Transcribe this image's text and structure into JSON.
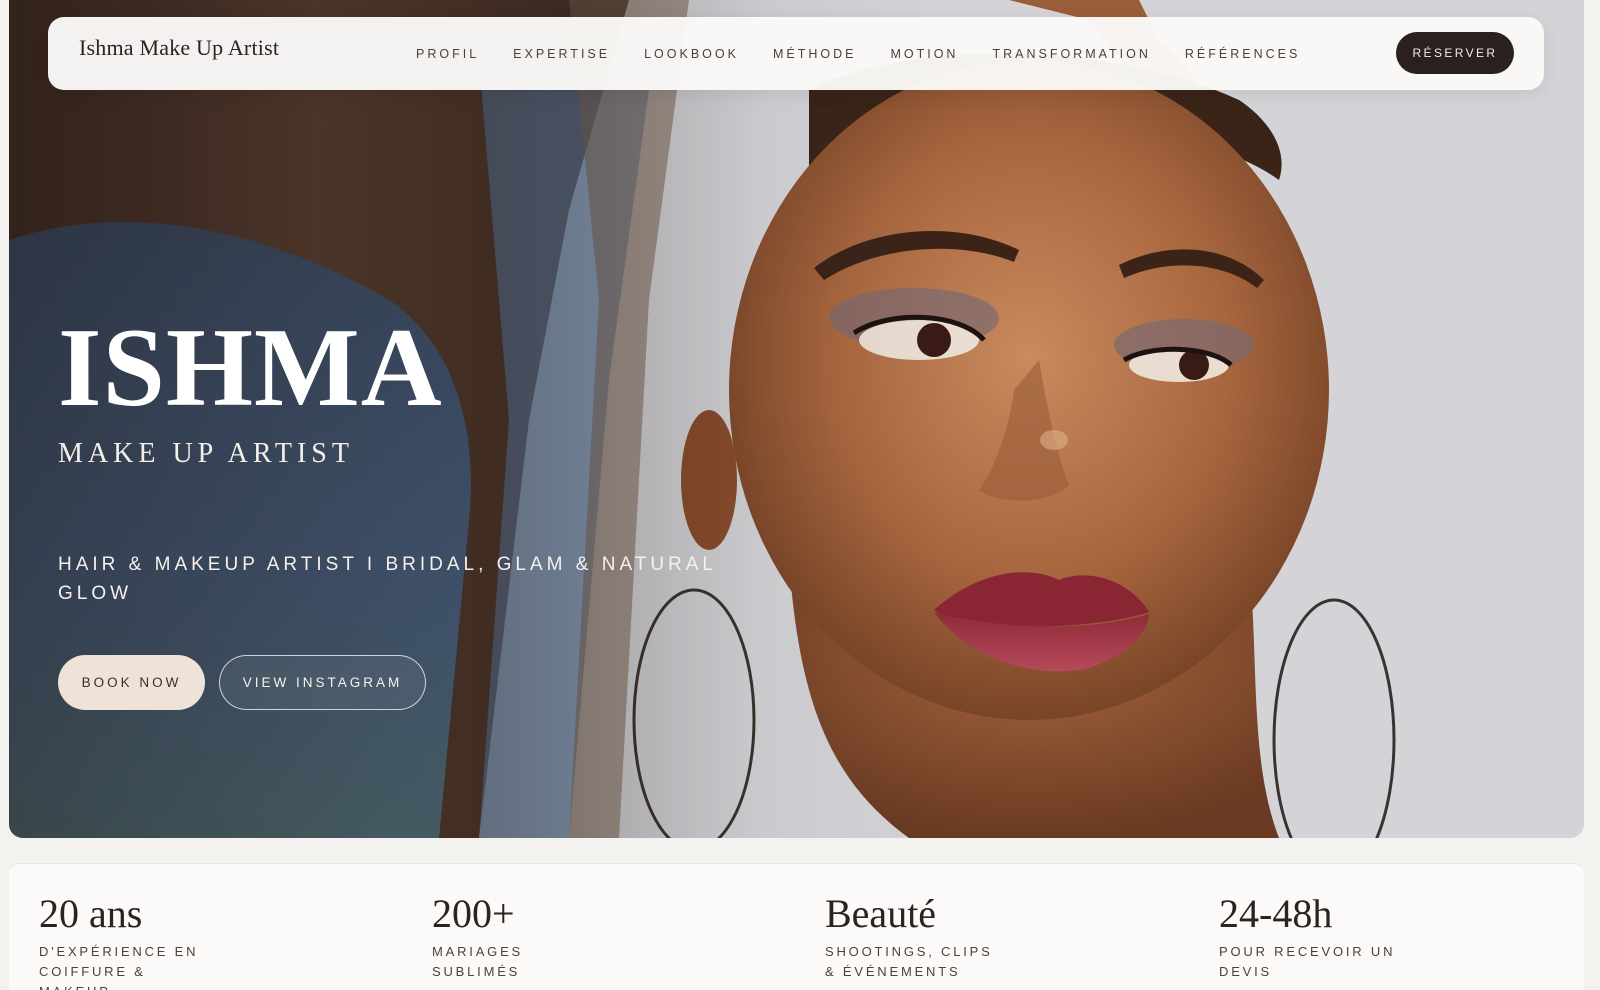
{
  "nav": {
    "brand": "Ishma Make Up Artist",
    "links": [
      {
        "label": "PROFIL"
      },
      {
        "label": "EXPERTISE"
      },
      {
        "label": "LOOKBOOK"
      },
      {
        "label": "MÉTHODE"
      },
      {
        "label": "MOTION"
      },
      {
        "label": "TRANSFORMATION"
      },
      {
        "label": "RÉFÉRENCES"
      }
    ],
    "cta": "RÉSERVER"
  },
  "hero": {
    "title": "ISHMA",
    "subtitle": "MAKE UP ARTIST",
    "tagline": "HAIR & MAKEUP ARTIST I BRIDAL, GLAM & NATURAL GLOW",
    "primary_button": "BOOK NOW",
    "secondary_button": "VIEW INSTAGRAM",
    "image": "portrait-photo"
  },
  "stats": [
    {
      "value": "20 ans",
      "label": "D'EXPÉRIENCE EN COIFFURE & MAKEUP"
    },
    {
      "value": "200+",
      "label": "MARIAGES SUBLIMÉS"
    },
    {
      "value": "Beauté",
      "label": "SHOOTINGS, CLIPS & ÉVÉNEMENTS"
    },
    {
      "value": "24-48h",
      "label": "POUR RECEVOIR UN DEVIS"
    }
  ],
  "colors": {
    "accent_dark": "#2a201e",
    "button_light": "#eee2d9",
    "background": "#f4f2ef"
  }
}
